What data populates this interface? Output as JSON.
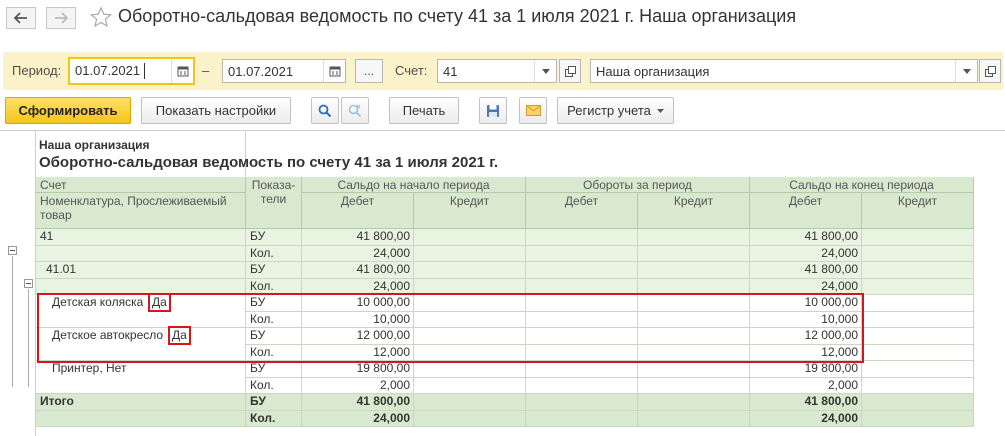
{
  "window": {
    "title": "Оборотно-сальдовая ведомость по счету 41 за 1 июля 2021 г. Наша организация"
  },
  "filters": {
    "period_label": "Период:",
    "date_from": "01.07.2021",
    "date_sep": "–",
    "date_to": "01.07.2021",
    "more_label": "...",
    "account_label": "Счет:",
    "account_value": "41",
    "organization_value": "Наша организация"
  },
  "toolbar": {
    "generate_label": "Сформировать",
    "settings_label": "Показать настройки",
    "print_label": "Печать",
    "register_label": "Регистр учета"
  },
  "report": {
    "organization": "Наша организация",
    "title": "Оборотно-сальдовая ведомость по счету 41 за 1 июля 2021 г.",
    "headers": {
      "account": "Счет",
      "nomenclature": "Номенклатура, Прослеживаемый товар",
      "indicators": "Показа-\nтели",
      "opening_balance": "Сальдо на начало периода",
      "turnover": "Обороты за период",
      "closing_balance": "Сальдо на конец периода",
      "debit": "Дебет",
      "credit": "Кредит"
    },
    "rows": [
      {
        "name": "41",
        "kind": "БУ",
        "open_debit": "41 800,00",
        "close_debit": "41 800,00"
      },
      {
        "name": "",
        "kind": "Кол.",
        "open_debit": "24,000",
        "close_debit": "24,000"
      },
      {
        "name": "41.01",
        "kind": "БУ",
        "open_debit": "41 800,00",
        "close_debit": "41 800,00"
      },
      {
        "name": "",
        "kind": "Кол.",
        "open_debit": "24,000",
        "close_debit": "24,000"
      },
      {
        "name": "Детская коляска",
        "flag": "Да",
        "kind": "БУ",
        "open_debit": "10 000,00",
        "close_debit": "10 000,00"
      },
      {
        "name": "",
        "kind": "Кол.",
        "open_debit": "10,000",
        "close_debit": "10,000"
      },
      {
        "name": "Детское автокресло",
        "flag": "Да",
        "kind": "БУ",
        "open_debit": "12 000,00",
        "close_debit": "12 000,00"
      },
      {
        "name": "",
        "kind": "Кол.",
        "open_debit": "12,000",
        "close_debit": "12,000"
      },
      {
        "name": "Принтер, Нет",
        "kind": "БУ",
        "open_debit": "19 800,00",
        "close_debit": "19 800,00"
      },
      {
        "name": "",
        "kind": "Кол.",
        "open_debit": "2,000",
        "close_debit": "2,000"
      },
      {
        "name": "Итого",
        "kind": "БУ",
        "open_debit": "41 800,00",
        "close_debit": "41 800,00"
      },
      {
        "name": "",
        "kind": "Кол.",
        "open_debit": "24,000",
        "close_debit": "24,000"
      }
    ]
  },
  "icons": {
    "back": "arrow-left-icon",
    "forward": "arrow-right-icon",
    "favorite": "star-icon",
    "calendar": "calendar-icon",
    "dropdown": "chevron-down-icon",
    "open": "open-form-icon",
    "search": "search-icon",
    "search_cancel": "search-cancel-icon",
    "save": "floppy-disk-icon",
    "mail": "envelope-icon",
    "collapse": "tree-collapse-icon"
  },
  "colors": {
    "accent": "#f5c519",
    "filter_bg": "#fbf2c9",
    "header_bg": "#d9e9d0",
    "group_bg": "#e8f3e1",
    "total_bg": "#d9e9d0",
    "highlight": "#d4171e"
  }
}
